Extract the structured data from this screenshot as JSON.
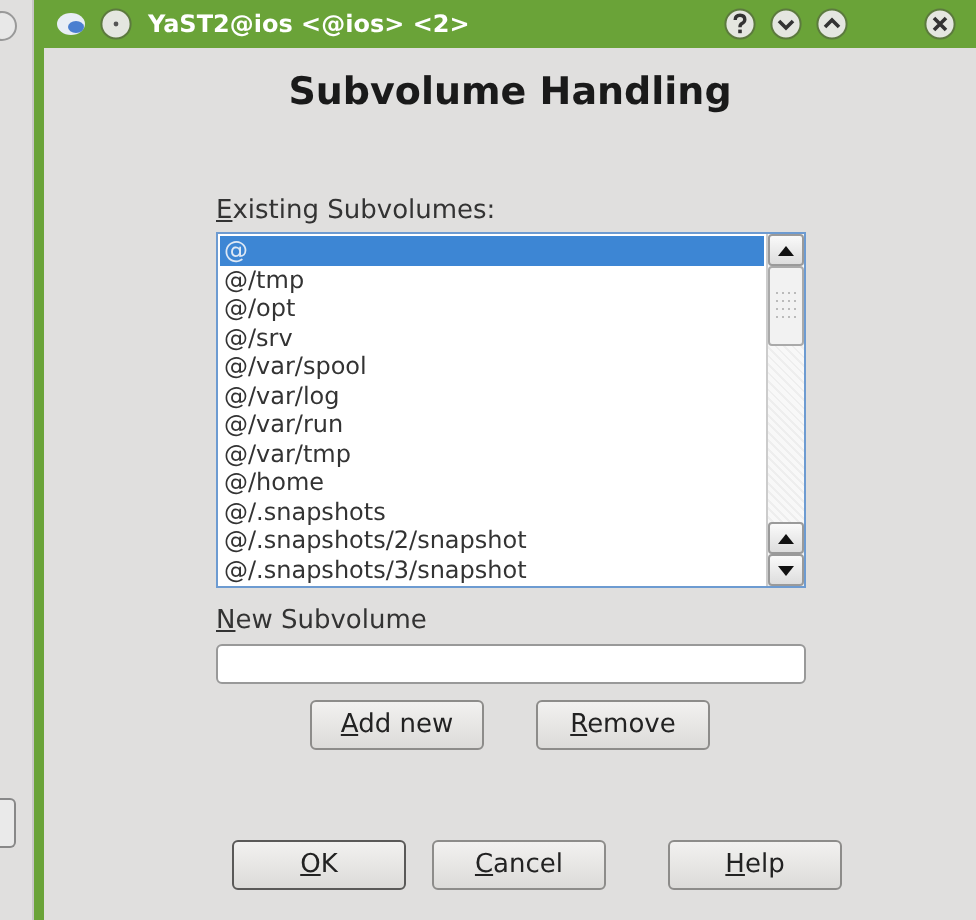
{
  "window": {
    "title": "YaST2@ios <@ios> <2>"
  },
  "heading": "Subvolume Handling",
  "existing_subvolumes": {
    "label": "Existing Subvolumes:",
    "items": [
      {
        "name": "@",
        "selected": true
      },
      {
        "name": "@/tmp",
        "selected": false
      },
      {
        "name": "@/opt",
        "selected": false
      },
      {
        "name": "@/srv",
        "selected": false
      },
      {
        "name": "@/var/spool",
        "selected": false
      },
      {
        "name": "@/var/log",
        "selected": false
      },
      {
        "name": "@/var/run",
        "selected": false
      },
      {
        "name": "@/var/tmp",
        "selected": false
      },
      {
        "name": "@/home",
        "selected": false
      },
      {
        "name": "@/.snapshots",
        "selected": false
      },
      {
        "name": "@/.snapshots/2/snapshot",
        "selected": false
      },
      {
        "name": "@/.snapshots/3/snapshot",
        "selected": false
      }
    ]
  },
  "new_subvolume": {
    "label": "New Subvolume"
  },
  "list_buttons": [
    "Add new",
    "Remove"
  ],
  "dialog_buttons": [
    {
      "label": "OK",
      "default": true
    },
    {
      "label": "Cancel",
      "default": false
    },
    {
      "label": "Help",
      "default": false
    }
  ]
}
